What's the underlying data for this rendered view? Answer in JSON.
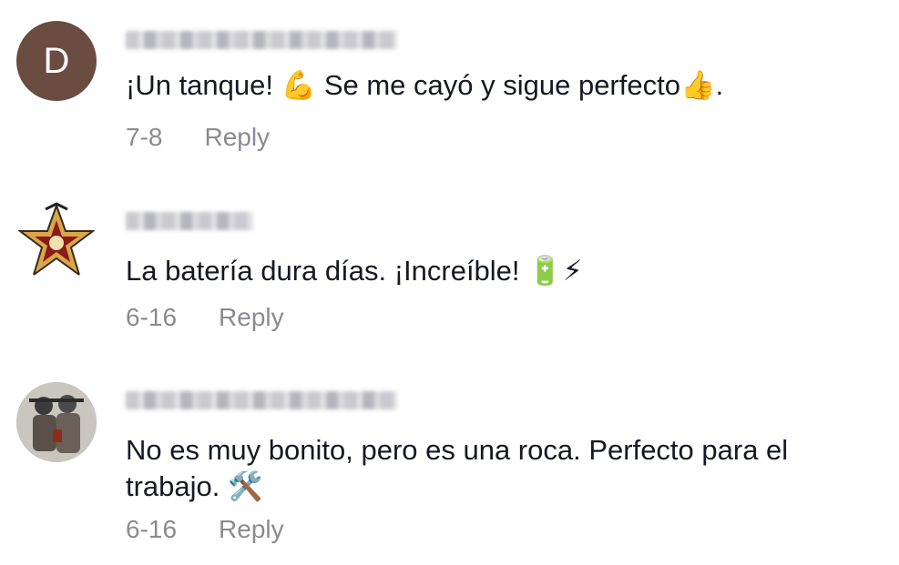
{
  "comments": [
    {
      "avatar_letter": "D",
      "avatar_color": "#6b4c41",
      "text": "¡Un tanque! 💪 Se me cayó y sigue perfecto👍.",
      "date": "7-8",
      "reply_label": "Reply"
    },
    {
      "avatar_icon": "star-badge-avatar",
      "text": "La batería dura días. ¡Increíble! 🔋⚡",
      "date": "6-16",
      "reply_label": "Reply"
    },
    {
      "avatar_icon": "soldier-photo-avatar",
      "text": "No es muy bonito, pero es una roca. Perfecto para el trabajo. 🛠️",
      "date": "6-16",
      "reply_label": "Reply"
    }
  ]
}
